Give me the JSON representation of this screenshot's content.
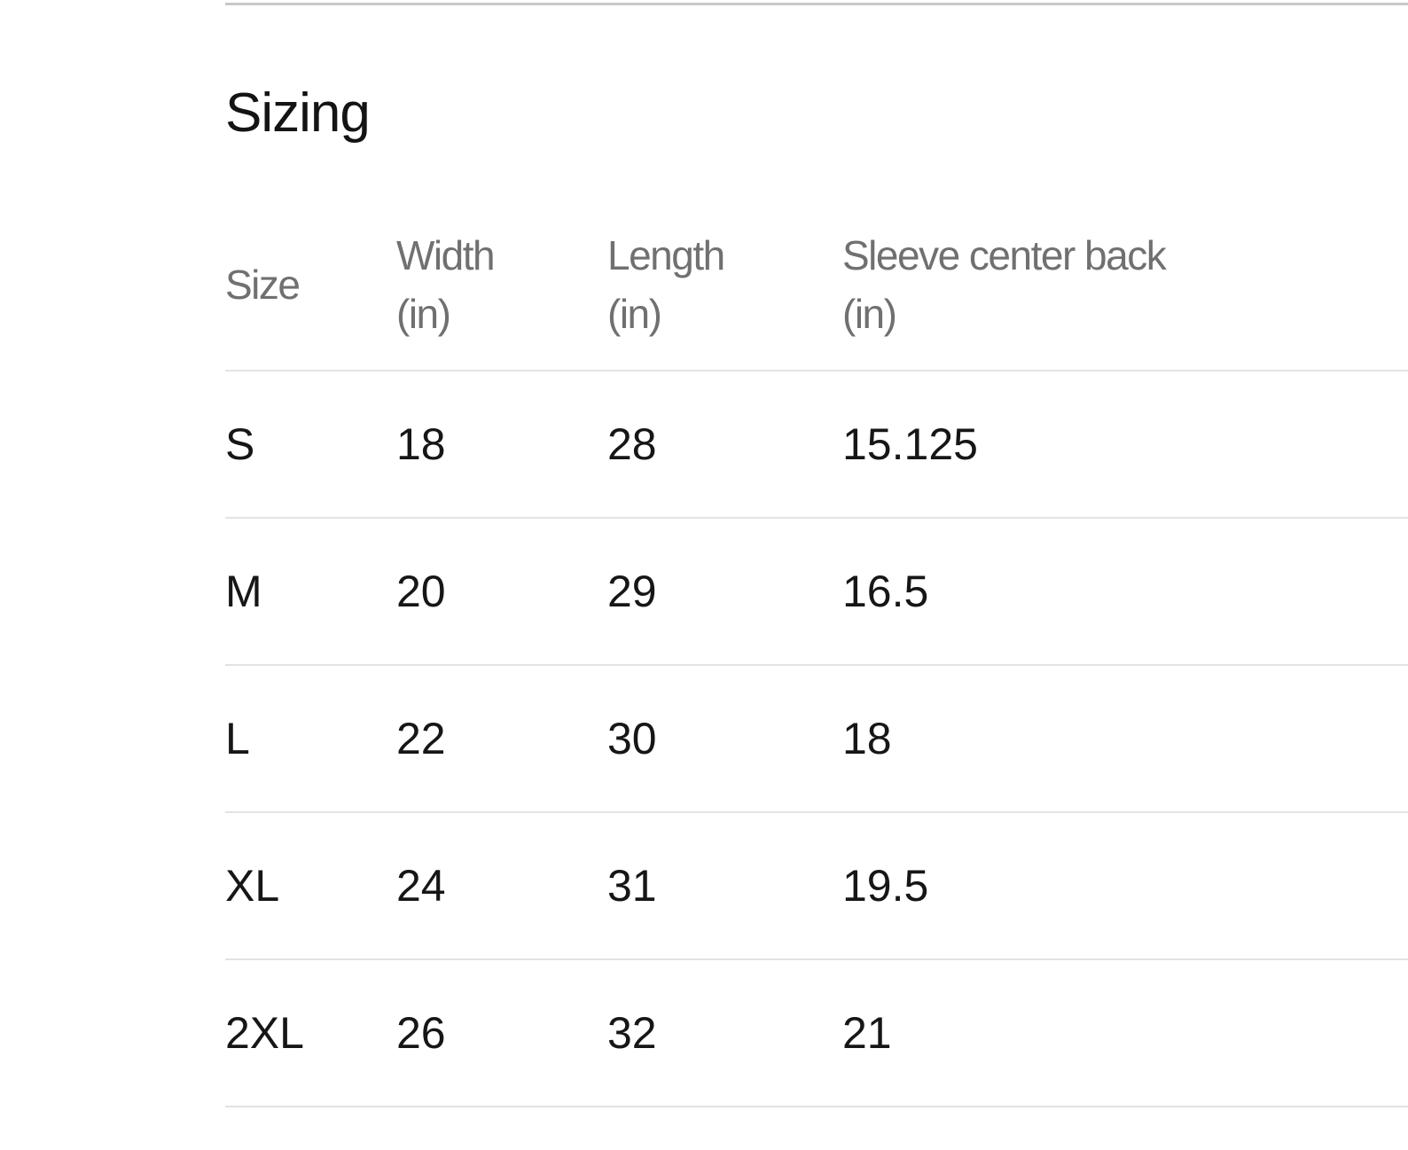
{
  "section": {
    "title": "Sizing"
  },
  "table": {
    "headers": [
      {
        "line1": "Size",
        "line2": ""
      },
      {
        "line1": "Width",
        "line2": "(in)"
      },
      {
        "line1": "Length",
        "line2": "(in)"
      },
      {
        "line1": "Sleeve center back",
        "line2": "(in)"
      }
    ],
    "rows": [
      {
        "size": "S",
        "width": "18",
        "length": "28",
        "sleeve": "15.125"
      },
      {
        "size": "M",
        "width": "20",
        "length": "29",
        "sleeve": "16.5"
      },
      {
        "size": "L",
        "width": "22",
        "length": "30",
        "sleeve": "18"
      },
      {
        "size": "XL",
        "width": "24",
        "length": "31",
        "sleeve": "19.5"
      },
      {
        "size": "2XL",
        "width": "26",
        "length": "32",
        "sleeve": "21"
      }
    ]
  }
}
